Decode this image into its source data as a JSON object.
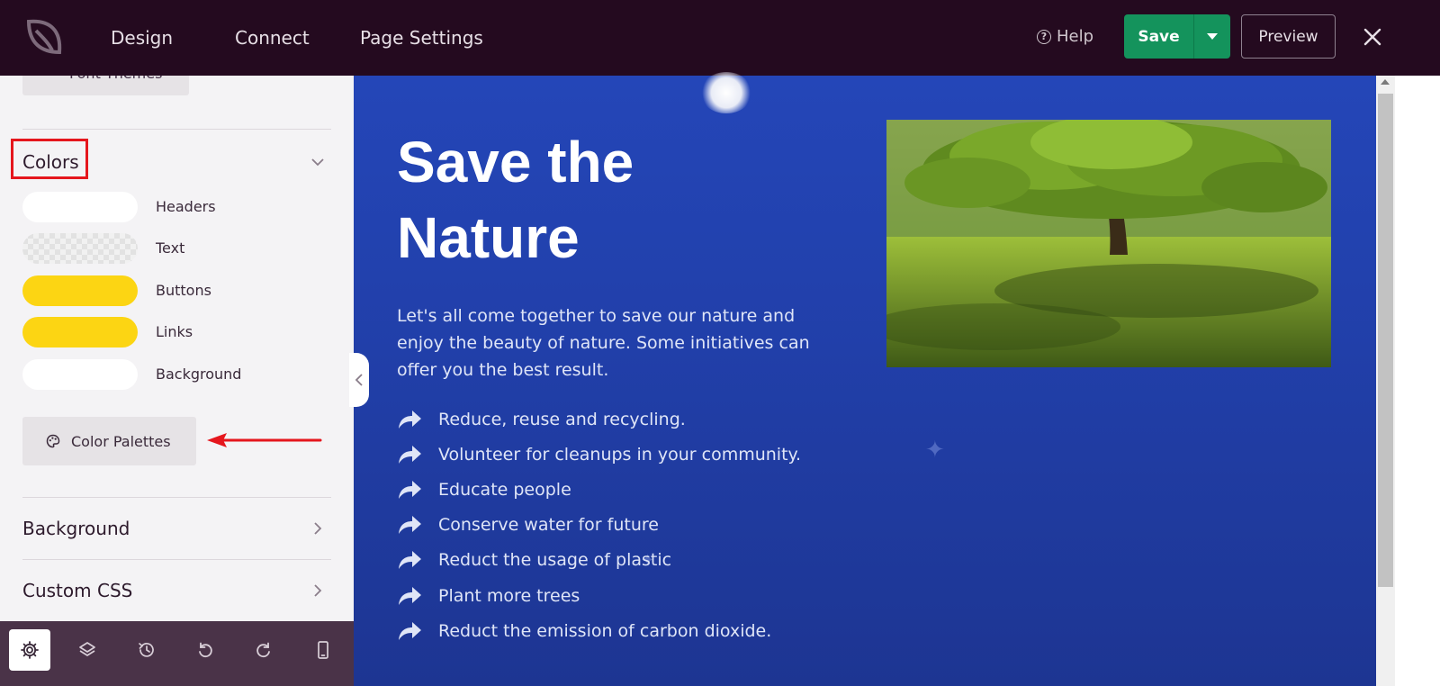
{
  "topbar": {
    "nav": [
      "Design",
      "Connect",
      "Page Settings"
    ],
    "help_label": "Help",
    "save_label": "Save",
    "preview_label": "Preview",
    "colors": {
      "bg": "#240a1f",
      "save_green": "#14935c"
    }
  },
  "sidebar": {
    "font_themes_label": "Font Themes",
    "colors_title": "Colors",
    "swatches": [
      {
        "label": "Headers",
        "color": "#ffffff"
      },
      {
        "label": "Text",
        "color": "transparent"
      },
      {
        "label": "Buttons",
        "color": "#fcd513"
      },
      {
        "label": "Links",
        "color": "#fcd513"
      },
      {
        "label": "Background",
        "color": "#ffffff"
      }
    ],
    "palette_button_label": "Color Palettes",
    "background_title": "Background",
    "custom_css_title": "Custom CSS"
  },
  "toolbar": {
    "tools": [
      "settings-icon",
      "layers-icon",
      "history-icon",
      "undo-icon",
      "redo-icon",
      "mobile-icon"
    ]
  },
  "canvas": {
    "title": "Save the Nature",
    "description": "Let's all come together to save our nature and enjoy the beauty of nature. Some initiatives can offer you the best result.",
    "bullets": [
      "Reduce, reuse and recycling.",
      "Volunteer for cleanups in your community.",
      "Educate people",
      "Conserve water for future",
      "Reduct the usage of plastic",
      "Plant more trees",
      "Reduct the emission of carbon dioxide."
    ],
    "bg_color": "#2446b8"
  }
}
